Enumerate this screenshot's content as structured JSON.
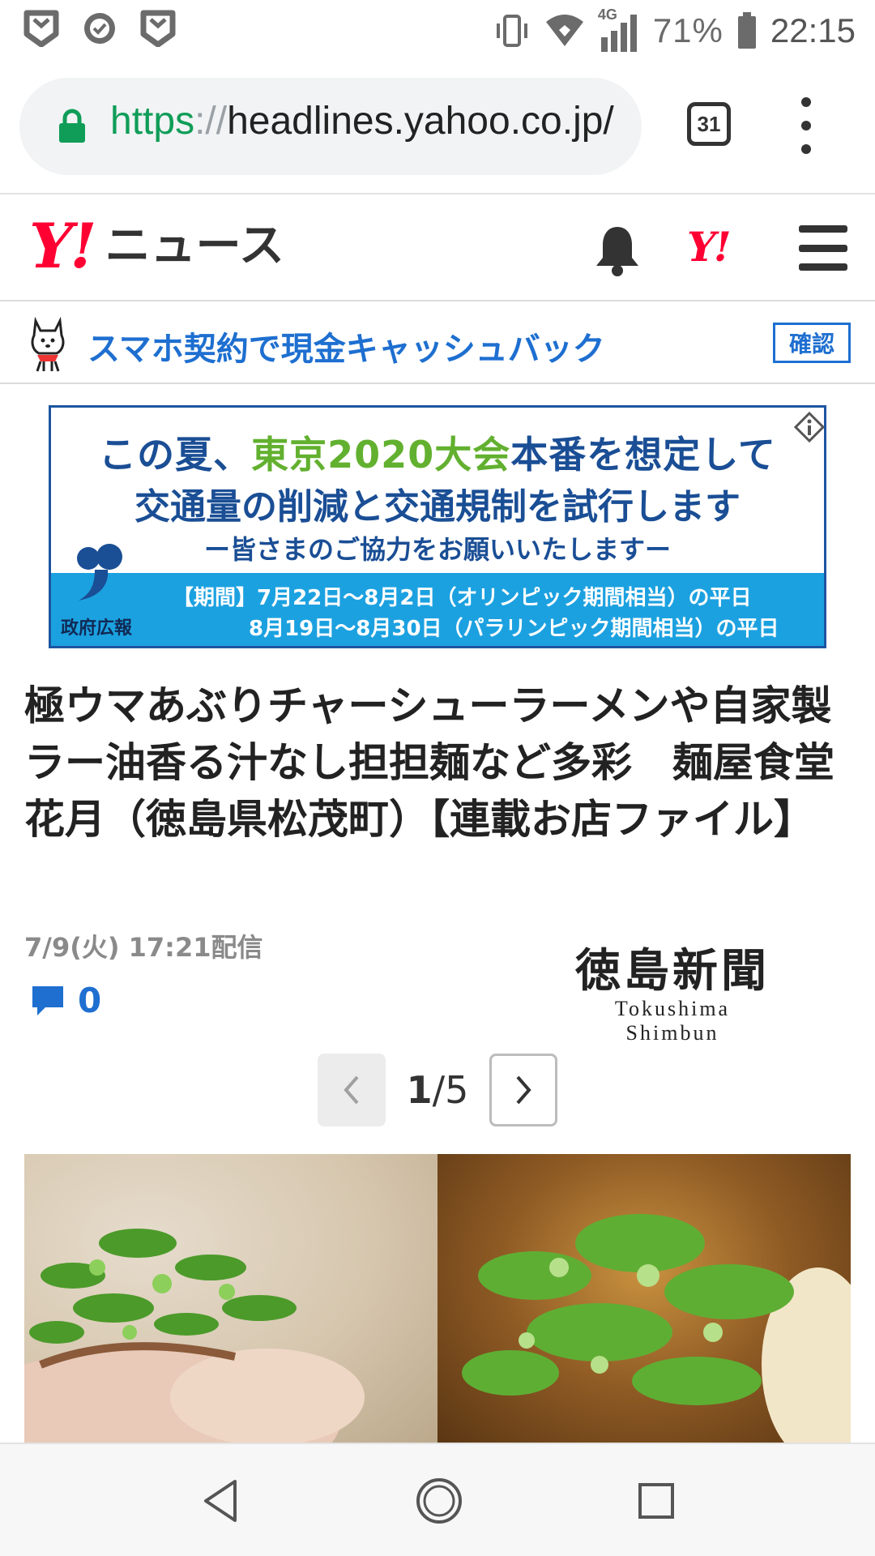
{
  "status_bar": {
    "battery_percent": "71%",
    "network": "4G",
    "time": "22:15",
    "left_icons": [
      "shield-notification-icon",
      "check-circle-icon",
      "shield-notification-icon"
    ],
    "right_icons": [
      "vibrate-icon",
      "wifi-icon",
      "cell-signal-icon",
      "battery-icon"
    ]
  },
  "browser": {
    "url_scheme": "https",
    "url_separator": "://",
    "url_host": "headlines.yahoo.co.jp/",
    "tab_count": "31",
    "lock_color": "#0f9d58"
  },
  "header": {
    "logo_mark": "Y!",
    "logo_text": "ニュース",
    "small_logo": "Y!",
    "brand_color": "#ff0033"
  },
  "promo": {
    "text": "スマホ契約で現金キャッシュバック",
    "button_label": "確認",
    "link_color": "#1e6fd0"
  },
  "ad": {
    "line1_pre": "この夏、",
    "line1_highlight": "東京2020大会",
    "line1_post": "本番を想定して",
    "line2": "交通量の削減と交通規制を試行します",
    "line3": "ー皆さまのご協力をお願いいたしますー",
    "period1": "【期間】7月22日〜8月2日（オリンピック期間相当）の平日",
    "period2": "8月19日〜8月30日（パラリンピック期間相当）の平日",
    "sponsor": "政府広報"
  },
  "article": {
    "headline": "極ウマあぶりチャーシューラーメンや自家製ラー油香る汁なし担担麺など多彩　麺屋食堂 花月（徳島県松茂町）【連載お店ファイル】",
    "date": "7/9(火) 17:21配信",
    "comment_count": "0",
    "publisher_ja": "徳島新聞",
    "publisher_en": "Tokushima Shimbun"
  },
  "pager": {
    "current": "1",
    "total": "/5"
  }
}
